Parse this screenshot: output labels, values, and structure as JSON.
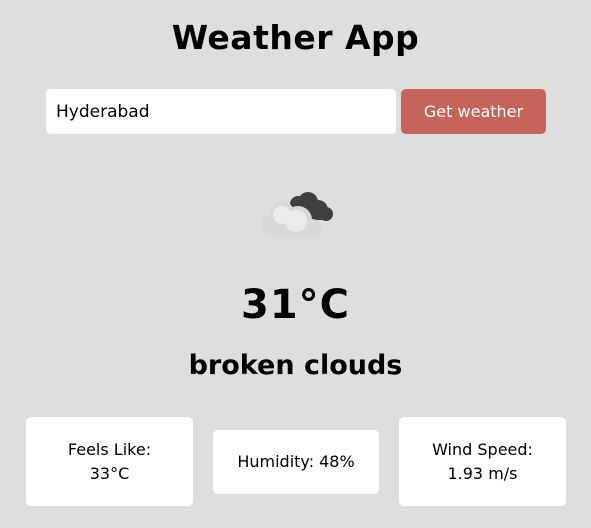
{
  "app": {
    "title": "Weather App"
  },
  "search": {
    "value": "Hyderabad",
    "button_label": "Get weather"
  },
  "current": {
    "icon": "broken-clouds-icon",
    "temperature": "31°C",
    "description": "broken clouds"
  },
  "details": {
    "feels_like": {
      "label": "Feels Like:",
      "value": "33°C"
    },
    "humidity": {
      "label": "Humidity:",
      "value": "48%"
    },
    "wind_speed": {
      "label": "Wind Speed:",
      "value": "1.93 m/s"
    }
  },
  "colors": {
    "background": "#e0dedd",
    "button": "#c6645a",
    "card": "#ffffff"
  }
}
